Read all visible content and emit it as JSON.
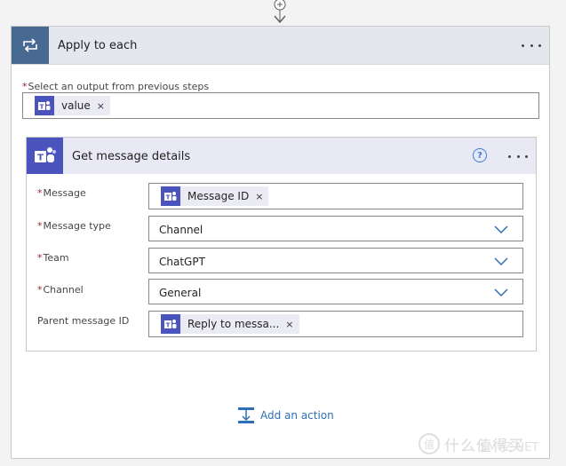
{
  "apply_to_each": {
    "title": "Apply to each",
    "select_output": {
      "label": "Select an output from previous steps",
      "required": "*",
      "token": "value"
    }
  },
  "action": {
    "title": "Get message details",
    "help_glyph": "?",
    "fields": {
      "message": {
        "required": "*",
        "label": "Message",
        "token": "Message ID"
      },
      "message_type": {
        "required": "*",
        "label": "Message type",
        "value": "Channel"
      },
      "team": {
        "required": "*",
        "label": "Team",
        "value": "ChatGPT"
      },
      "channel": {
        "required": "*",
        "label": "Channel",
        "value": "General"
      },
      "parent_message_id": {
        "label": "Parent message ID",
        "token": "Reply to messa..."
      }
    }
  },
  "add_action": {
    "label": "Add an action"
  },
  "token_remove_glyph": "×",
  "watermark": {
    "text": "什么值得买",
    "overlay": "SMYZ.NET"
  },
  "colors": {
    "loop_header_icon_bg": "#486991",
    "loop_header_bg": "#e4e7ee",
    "teams_purple": "#4b53bc",
    "action_header_bg": "#e9e9f6",
    "token_bg": "#ebebf3",
    "link_blue": "#2f6fb7",
    "required_red": "#a4262c"
  },
  "icons": {
    "connector": "plus-circle-arrow-icon",
    "loop": "loop-arrows-icon",
    "teams": "microsoft-teams-icon",
    "more": "ellipsis-icon",
    "help": "help-circle-icon",
    "chevron": "chevron-down-icon",
    "add_action": "add-action-icon"
  }
}
